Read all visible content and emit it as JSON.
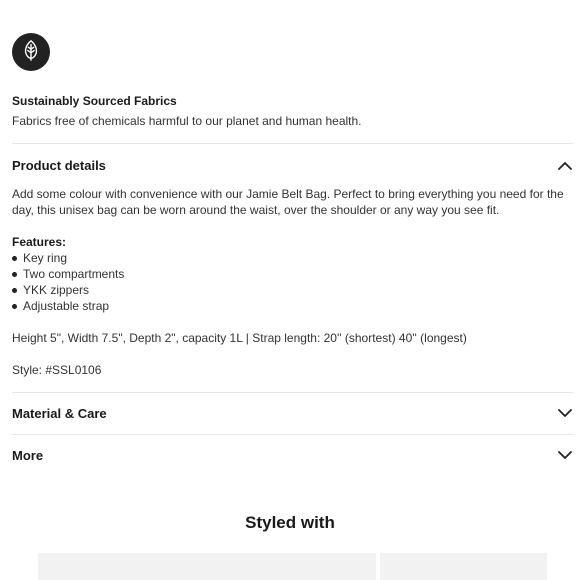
{
  "feature": {
    "icon": "leaf-icon",
    "title": "Sustainably Sourced Fabrics",
    "description": "Fabrics free of chemicals harmful to our planet and human health."
  },
  "sections": {
    "product_details": {
      "label": "Product details",
      "expanded": true,
      "description": "Add some colour with convenience with our Jamie Belt Bag. Perfect to bring everything you need for the day, this unisex bag can be worn around the waist, over the shoulder or any way you see fit.",
      "features_label": "Features:",
      "features": [
        "Key ring",
        "Two compartments",
        "YKK zippers",
        "Adjustable strap"
      ],
      "specs": "Height 5\", Width 7.5\", Depth 2\", capacity 1L | Strap length: 20'' (shortest) 40'' (longest)",
      "style": "Style: #SSL0106"
    },
    "material_care": {
      "label": "Material & Care",
      "expanded": false
    },
    "more": {
      "label": "More",
      "expanded": false
    }
  },
  "styled_with": {
    "title": "Styled with"
  },
  "colors": {
    "text": "#222222",
    "divider": "#e6e6e6",
    "badge": "#222222",
    "thumb": "#f2f2f2"
  }
}
